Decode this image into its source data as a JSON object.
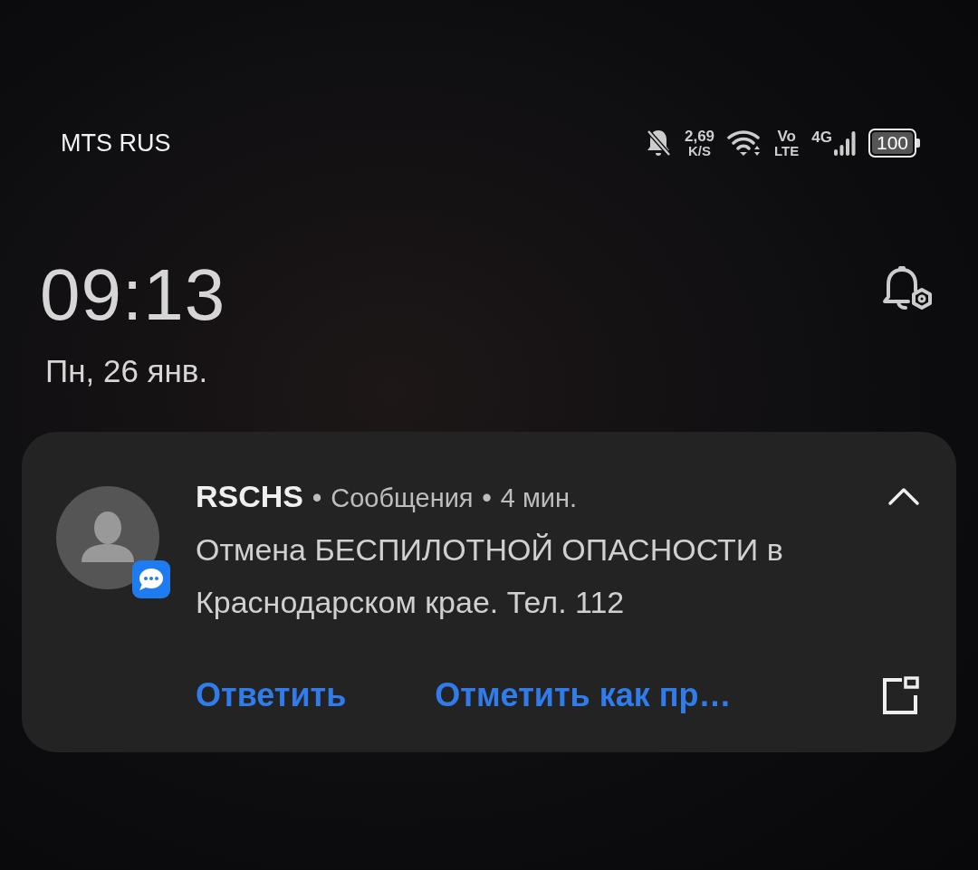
{
  "status_bar": {
    "carrier": "MTS RUS",
    "speed_value": "2,69",
    "speed_unit": "K/S",
    "volte_top": "Vo",
    "volte_bottom": "LTE",
    "network": "4G",
    "battery": "100"
  },
  "clock": {
    "time": "09:13",
    "date": "Пн, 26 янв."
  },
  "notification": {
    "sender": "RSCHS",
    "separator": "•",
    "app": "Сообщения",
    "time": "4 мин.",
    "expanded": true,
    "message": "Отмена БЕСПИЛОТНОЙ ОПАСНОСТИ в Краснодарском крае. Тел. 112",
    "actions": [
      "Ответить",
      "Отметить как пр…"
    ]
  }
}
